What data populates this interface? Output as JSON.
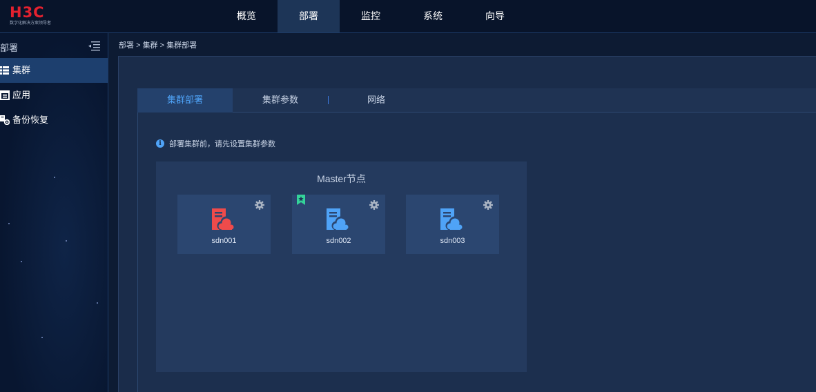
{
  "brand": {
    "logo_text": "H3C",
    "logo_tagline": "数字化解决方案领导者",
    "logo_color": "#e3212f"
  },
  "nav": {
    "items": [
      {
        "label": "概览",
        "active": false
      },
      {
        "label": "部署",
        "active": true
      },
      {
        "label": "监控",
        "active": false
      },
      {
        "label": "系统",
        "active": false
      },
      {
        "label": "向导",
        "active": false
      }
    ]
  },
  "sidebar": {
    "title": "部署",
    "collapse_icon": "menu-fold-icon",
    "items": [
      {
        "label": "集群",
        "icon": "server-list-icon",
        "active": true
      },
      {
        "label": "应用",
        "icon": "app-window-icon",
        "active": false
      },
      {
        "label": "备份恢复",
        "icon": "backup-settings-icon",
        "active": false
      }
    ]
  },
  "breadcrumb": {
    "items": [
      "部署",
      "集群",
      "集群部署"
    ],
    "separator": ">"
  },
  "tabs": {
    "items": [
      {
        "label": "集群部署",
        "active": true
      },
      {
        "label": "集群参数",
        "active": false
      },
      {
        "label": "网络",
        "active": false
      }
    ]
  },
  "info": {
    "icon": "info-icon",
    "text": "部署集群前，请先设置集群参数"
  },
  "master": {
    "title": "Master节点",
    "nodes": [
      {
        "name": "sdn001",
        "status_color": "#ef4b4b",
        "primary": false
      },
      {
        "name": "sdn002",
        "status_color": "#4fa3f7",
        "primary": true
      },
      {
        "name": "sdn003",
        "status_color": "#4fa3f7",
        "primary": false
      }
    ]
  },
  "colors": {
    "accent": "#4fa3f7",
    "primary_flag": "#34d399",
    "error": "#ef4b4b"
  }
}
